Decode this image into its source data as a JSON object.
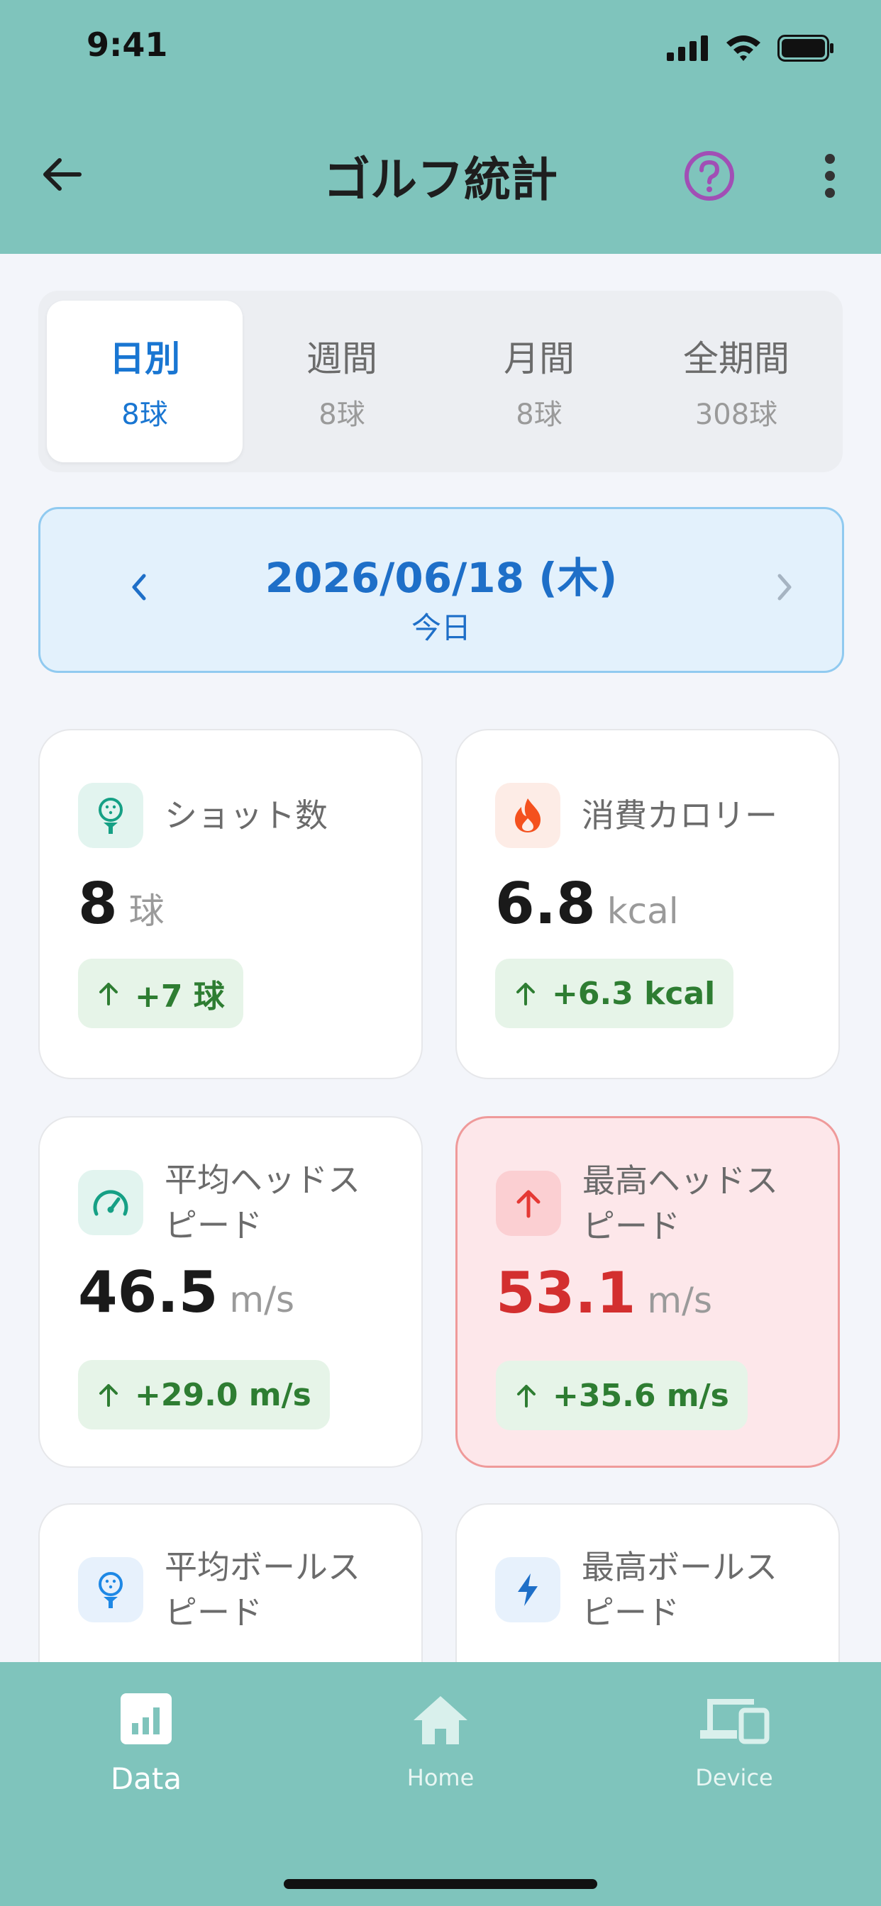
{
  "status_bar": {
    "time": "9:41"
  },
  "header": {
    "title": "ゴルフ統計"
  },
  "tabs": [
    {
      "label": "日別",
      "count": "8球",
      "active": true
    },
    {
      "label": "週間",
      "count": "8球",
      "active": false
    },
    {
      "label": "月間",
      "count": "8球",
      "active": false
    },
    {
      "label": "全期間",
      "count": "308球",
      "active": false
    }
  ],
  "date": {
    "main": "2026/06/18 (木)",
    "sub": "今日"
  },
  "cards": [
    {
      "title": "ショット数",
      "value": "8",
      "unit": "球",
      "delta": "+7 球",
      "icon": "golf-ball-tee-icon"
    },
    {
      "title": "消費カロリー",
      "value": "6.8",
      "unit": "kcal",
      "delta": "+6.3 kcal",
      "icon": "flame-icon"
    },
    {
      "title_line1": "平均ヘッドス",
      "title_line2": "ピード",
      "value": "46.5",
      "unit": "m/s",
      "delta": "+29.0 m/s",
      "icon": "speedometer-icon"
    },
    {
      "title_line1": "最高ヘッドス",
      "title_line2": "ピード",
      "value": "53.1",
      "unit": "m/s",
      "delta": "+35.6 m/s",
      "icon": "arrow-up-icon"
    },
    {
      "title_line1": "平均ボールス",
      "title_line2": "ピード",
      "icon": "golf-ball-tee-icon"
    },
    {
      "title_line1": "最高ボールス",
      "title_line2": "ピード",
      "icon": "lightning-icon"
    }
  ],
  "bottom_nav": [
    {
      "label": "Data",
      "active": true,
      "icon": "bar-chart-icon"
    },
    {
      "label": "Home",
      "active": false,
      "icon": "home-icon"
    },
    {
      "label": "Device",
      "active": false,
      "icon": "devices-icon"
    }
  ],
  "colors": {
    "header_bg": "#7FC4BC",
    "accent_blue": "#1976D2",
    "positive_green": "#2E7D32",
    "highlight_red": "#D32F2F"
  }
}
